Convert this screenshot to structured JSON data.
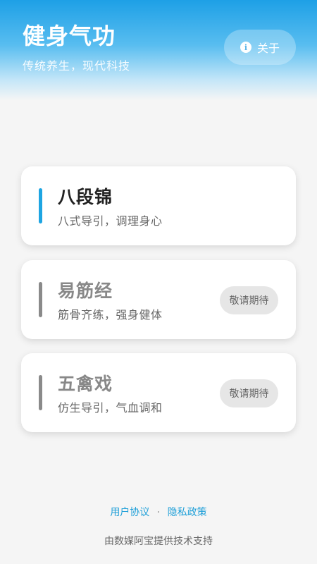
{
  "header": {
    "title": "健身气功",
    "subtitle": "传统养生，现代科技",
    "about_label": "关于",
    "about_icon": "info-icon"
  },
  "cards": [
    {
      "title": "八段锦",
      "desc": "八式导引，调理身心",
      "badge": "",
      "active": true
    },
    {
      "title": "易筋经",
      "desc": "筋骨齐练，强身健体",
      "badge": "敬请期待",
      "active": false
    },
    {
      "title": "五禽戏",
      "desc": "仿生导引，气血调和",
      "badge": "敬请期待",
      "active": false
    }
  ],
  "footer": {
    "user_agreement": "用户协议",
    "separator": "·",
    "privacy_policy": "隐私政策",
    "support_text": "由数媒阿宝提供技术支持"
  },
  "colors": {
    "accent": "#1ea5e2",
    "link": "#1e9fd8",
    "inactive_bar": "#8a8a8a"
  }
}
